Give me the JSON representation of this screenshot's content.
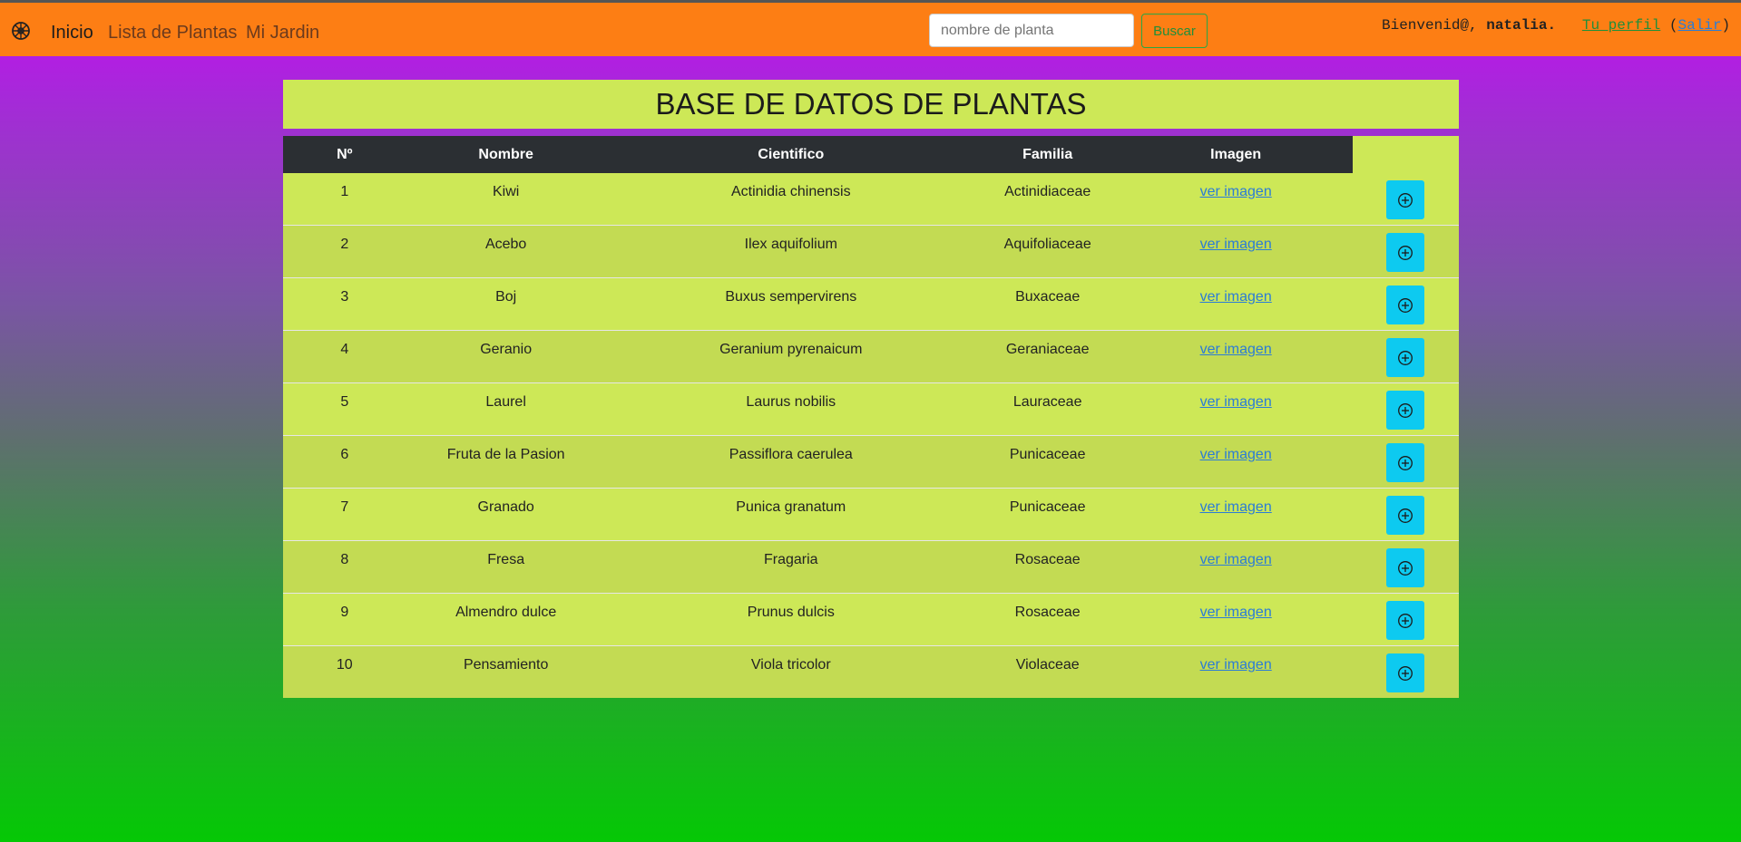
{
  "nav": {
    "logo_icon": "flower-icon",
    "links": [
      "Inicio",
      "Lista de Plantas",
      "Mi Jardin"
    ],
    "search": {
      "placeholder": "nombre de planta",
      "button": "Buscar"
    },
    "welcome_prefix": "Bienvenid@, ",
    "user": "natalia",
    "profile": "Tu perfil",
    "exit": "Salir"
  },
  "page": {
    "title": "BASE DE DATOS DE PLANTAS"
  },
  "table": {
    "headers": [
      "Nº",
      "Nombre",
      "Cientifico",
      "Familia",
      "Imagen"
    ],
    "link_label": "ver imagen",
    "rows": [
      {
        "n": "1",
        "nombre": "Kiwi",
        "cientifico": "Actinidia chinensis",
        "familia": "Actinidiaceae"
      },
      {
        "n": "2",
        "nombre": "Acebo",
        "cientifico": "Ilex aquifolium",
        "familia": "Aquifoliaceae"
      },
      {
        "n": "3",
        "nombre": "Boj",
        "cientifico": "Buxus sempervirens",
        "familia": "Buxaceae"
      },
      {
        "n": "4",
        "nombre": "Geranio",
        "cientifico": "Geranium pyrenaicum",
        "familia": "Geraniaceae"
      },
      {
        "n": "5",
        "nombre": "Laurel",
        "cientifico": "Laurus nobilis",
        "familia": "Lauraceae"
      },
      {
        "n": "6",
        "nombre": "Fruta de la Pasion",
        "cientifico": "Passiflora caerulea",
        "familia": "Punicaceae"
      },
      {
        "n": "7",
        "nombre": "Granado",
        "cientifico": "Punica granatum",
        "familia": "Punicaceae"
      },
      {
        "n": "8",
        "nombre": "Fresa",
        "cientifico": "Fragaria",
        "familia": "Rosaceae"
      },
      {
        "n": "9",
        "nombre": "Almendro dulce",
        "cientifico": "Prunus dulcis",
        "familia": "Rosaceae"
      },
      {
        "n": "10",
        "nombre": "Pensamiento",
        "cientifico": "Viola tricolor",
        "familia": "Violaceae"
      }
    ],
    "add_icon": "plus-circle-icon"
  }
}
